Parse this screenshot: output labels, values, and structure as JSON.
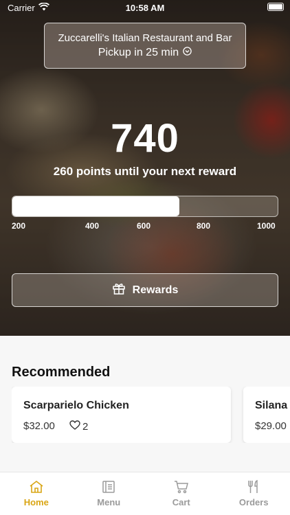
{
  "status_bar": {
    "carrier": "Carrier",
    "time": "10:58 AM"
  },
  "store": {
    "name": "Zuccarelli's Italian Restaurant and Bar",
    "pickup": "Pickup in 25 min"
  },
  "loyalty": {
    "points": "740",
    "until_text": "260 points until your next reward",
    "progress_fraction": 0.63,
    "ticks": [
      "200",
      "400",
      "600",
      "800",
      "1000"
    ]
  },
  "rewards_button": {
    "label": "Rewards"
  },
  "recommended": {
    "title": "Recommended",
    "items": [
      {
        "name": "Scarparielo Chicken",
        "price": "$32.00",
        "likes": "2"
      },
      {
        "name": "Silana",
        "price": "$29.00"
      }
    ]
  },
  "tabs": [
    {
      "label": "Home",
      "icon": "home-icon",
      "active": true
    },
    {
      "label": "Menu",
      "icon": "menu-icon",
      "active": false
    },
    {
      "label": "Cart",
      "icon": "cart-icon",
      "active": false
    },
    {
      "label": "Orders",
      "icon": "utensils-icon",
      "active": false
    }
  ],
  "colors": {
    "accent": "#d9a514",
    "inactive_tab": "#9a9a9a"
  }
}
